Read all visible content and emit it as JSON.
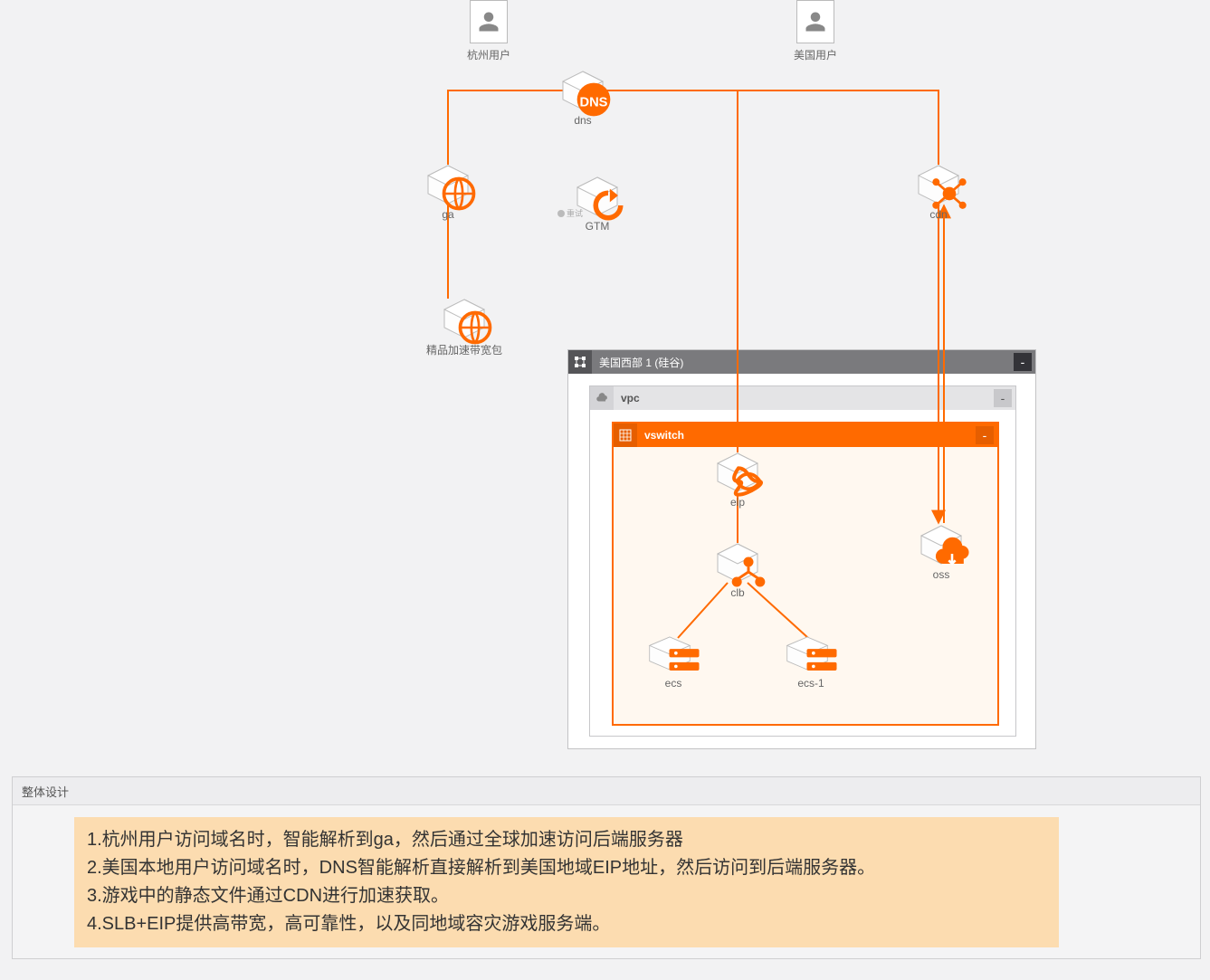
{
  "users": {
    "hangzhou": "杭州用户",
    "us": "美国用户"
  },
  "nodes": {
    "dns": "dns",
    "ga": "ga",
    "gtm": "GTM",
    "cdn": "cdn",
    "bandwidth": "精品加速带宽包",
    "eip": "eip",
    "clb": "clb",
    "ecs": "ecs",
    "ecs1": "ecs-1",
    "oss": "oss"
  },
  "groups": {
    "region": "美国西部 1 (硅谷)",
    "vpc": "vpc",
    "vswitch": "vswitch"
  },
  "panel": {
    "title": "整体设计",
    "lines": [
      "1.杭州用户访问域名时，智能解析到ga，然后通过全球加速访问后端服务器",
      "2.美国本地用户访问域名时，DNS智能解析直接解析到美国地域EIP地址，然后访问到后端服务器。",
      "3.游戏中的静态文件通过CDN进行加速获取。",
      "4.SLB+EIP提供高带宽，高可靠性，以及同地域容灾游戏服务端。"
    ]
  },
  "collapse_label": "-",
  "gtm_tag": "重试"
}
